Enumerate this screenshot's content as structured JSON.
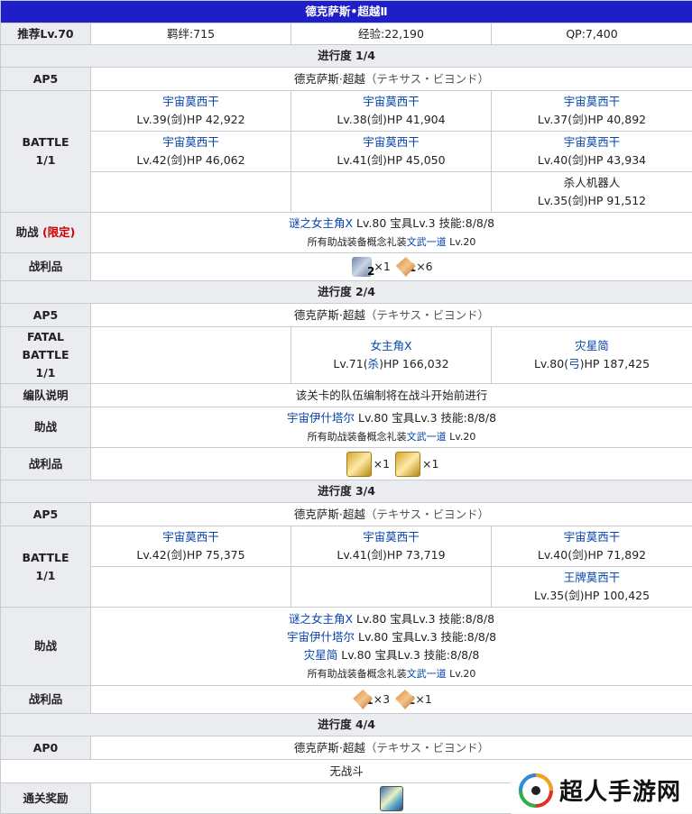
{
  "title": "德克萨斯•超越Ⅱ",
  "summary": {
    "recommended": "推荐Lv.70",
    "bond": "羁绊:715",
    "exp": "经验:22,190",
    "qp": "QP:7,400"
  },
  "sections": [
    {
      "progress": "进行度 1/4",
      "ap_label": "AP5",
      "quest_name": "德克萨斯·超越",
      "quest_name_jp": "（テキサス・ビヨンド）",
      "battle_label_1": "BATTLE",
      "battle_label_2": "1/1",
      "enemies": [
        {
          "name": "宇宙莫西干",
          "stats": "Lv.39(剑)HP 42,922"
        },
        {
          "name": "宇宙莫西干",
          "stats": "Lv.38(剑)HP 41,904"
        },
        {
          "name": "宇宙莫西干",
          "stats": "Lv.37(剑)HP 40,892"
        },
        {
          "name": "宇宙莫西干",
          "stats": "Lv.42(剑)HP 46,062"
        },
        {
          "name": "宇宙莫西干",
          "stats": "Lv.41(剑)HP 45,050"
        },
        {
          "name": "宇宙莫西干",
          "stats": "Lv.40(剑)HP 43,934"
        },
        {
          "name": "杀人机器人",
          "stats": "Lv.35(剑)HP 91,512"
        }
      ],
      "support_label": "助战",
      "support_limited": "(限定)",
      "support_lines": [
        {
          "name": "谜之女主角X",
          "detail": " Lv.80 宝具Lv.3 技能:8/8/8"
        }
      ],
      "support_ce_prefix": "所有助战装备概念礼装",
      "support_ce_name": "文武一道",
      "support_ce_level": " Lv.20",
      "drops_label": "战利品",
      "drops": [
        {
          "icon": "piece-icon",
          "badge": "2",
          "count": "×1"
        },
        {
          "icon": "monument-icon",
          "badge": "1",
          "count": "×6"
        }
      ]
    },
    {
      "progress": "进行度 2/4",
      "ap_label": "AP5",
      "quest_name": "德克萨斯·超越",
      "quest_name_jp": "（テキサス・ビヨンド）",
      "battle_label_1": "FATAL",
      "battle_label_2": "BATTLE",
      "battle_label_3": "1/1",
      "enemies": [
        {
          "name": "女主角X",
          "stats_pre": "Lv.71(",
          "stats_class": "杀",
          "stats_post": ")HP 166,032"
        },
        {
          "name": "灾星简",
          "stats_pre": "Lv.80(",
          "stats_class": "弓",
          "stats_post": ")HP 187,425"
        }
      ],
      "formation_label": "编队说明",
      "formation_text": "该关卡的队伍编制将在战斗开始前进行",
      "support_label": "助战",
      "support_lines": [
        {
          "name": "宇宙伊什塔尔",
          "detail": " Lv.80 宝具Lv.3 技能:8/8/8"
        }
      ],
      "support_ce_prefix": "所有助战装备概念礼装",
      "support_ce_name": "文武一道",
      "support_ce_level": " Lv.20",
      "drops_label": "战利品",
      "drops": [
        {
          "icon": "gold-statue-icon",
          "count": "×1"
        },
        {
          "icon": "gold-gem-icon",
          "count": "×1"
        }
      ]
    },
    {
      "progress": "进行度 3/4",
      "ap_label": "AP5",
      "quest_name": "德克萨斯·超越",
      "quest_name_jp": "（テキサス・ビヨンド）",
      "battle_label_1": "BATTLE",
      "battle_label_2": "1/1",
      "enemies": [
        {
          "name": "宇宙莫西干",
          "stats": "Lv.42(剑)HP 75,375"
        },
        {
          "name": "宇宙莫西干",
          "stats": "Lv.41(剑)HP 73,719"
        },
        {
          "name": "宇宙莫西干",
          "stats": "Lv.40(剑)HP 71,892"
        },
        {
          "name": "王牌莫西干",
          "stats": "Lv.35(剑)HP 100,425"
        }
      ],
      "support_label": "助战",
      "support_lines": [
        {
          "name": "谜之女主角X",
          "detail": " Lv.80 宝具Lv.3 技能:8/8/8"
        },
        {
          "name": "宇宙伊什塔尔",
          "detail": " Lv.80 宝具Lv.3 技能:8/8/8"
        },
        {
          "name": "灾星简",
          "detail": " Lv.80 宝具Lv.3 技能:8/8/8"
        }
      ],
      "support_ce_prefix": "所有助战装备概念礼装",
      "support_ce_name": "文武一道",
      "support_ce_level": " Lv.20",
      "drops_label": "战利品",
      "drops": [
        {
          "icon": "monument-icon",
          "badge": "1",
          "count": "×3"
        },
        {
          "icon": "monument-icon",
          "badge": "2",
          "count": "×1"
        }
      ]
    },
    {
      "progress": "进行度 4/4",
      "ap_label": "AP0",
      "quest_name": "德克萨斯·超越",
      "quest_name_jp": "（テキサス・ビヨンド）",
      "no_battle": "无战斗",
      "reward_label": "通关奖励",
      "reward_icon": "craft-essence-icon"
    }
  ],
  "watermark": {
    "text": "超人手游网"
  }
}
